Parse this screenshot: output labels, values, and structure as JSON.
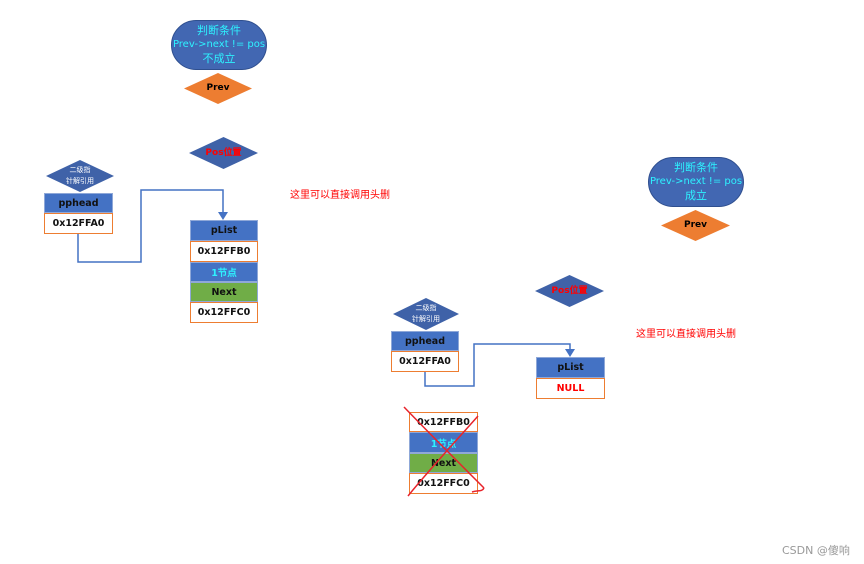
{
  "left": {
    "condition": {
      "title": "判断条件",
      "expr": "Prev->next != pos",
      "result": "不成立"
    },
    "prev": "Prev",
    "pos": "Pos位置",
    "deref": [
      "二级指",
      "针解引用"
    ],
    "pphead": {
      "label": "pphead",
      "value": "0x12FFA0"
    },
    "plist": {
      "label": "pList",
      "addr": "0x12FFB0",
      "node": "1节点",
      "next": "Next",
      "next_value": "0x12FFC0"
    },
    "note": "这里可以直接调用头删"
  },
  "right": {
    "condition": {
      "title": "判断条件",
      "expr": "Prev->next != pos",
      "result": "成立"
    },
    "prev": "Prev",
    "pos": "Pos位置",
    "deref": [
      "二级指",
      "针解引用"
    ],
    "pphead": {
      "label": "pphead",
      "value": "0x12FFA0"
    },
    "plist": {
      "label": "pList",
      "value": "NULL"
    },
    "deleted": {
      "addr": "0x12FFB0",
      "node": "1节点",
      "next": "Next",
      "next_value": "0x12FFC0"
    },
    "note": "这里可以直接调用头删"
  },
  "watermark": "CSDN @傻响",
  "colors": {
    "blue": "#4472c4",
    "orange": "#ed7d31",
    "green": "#70ad47",
    "cyan": "#2ef2ff",
    "red": "#ff0000"
  }
}
